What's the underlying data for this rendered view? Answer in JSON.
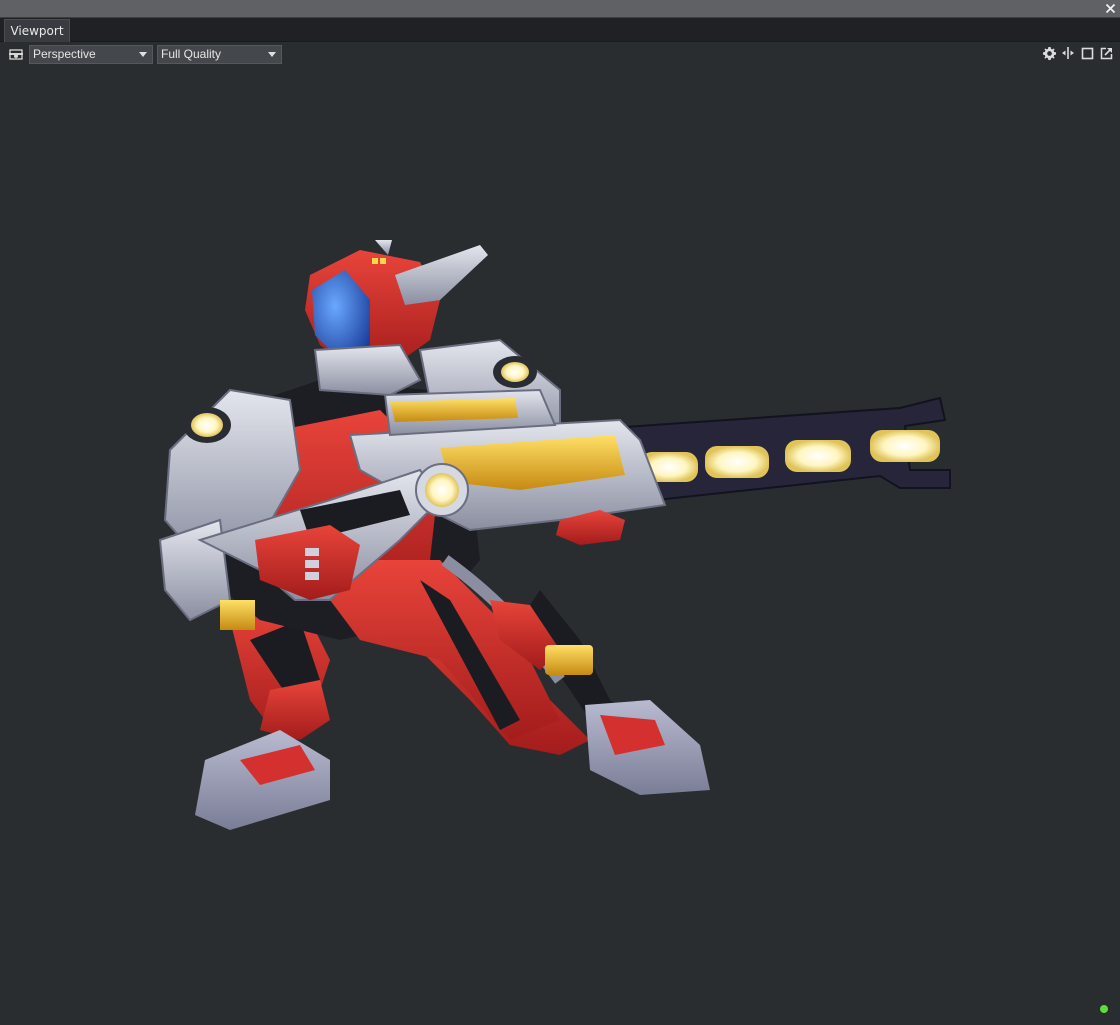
{
  "panel": {
    "tab_label": "Viewport"
  },
  "toolbar": {
    "camera_mode": "Perspective",
    "quality": "Full Quality"
  },
  "icons": {
    "camera": "camera-icon",
    "settings": "gear-icon",
    "split": "split-view-icon",
    "maximize": "maximize-icon",
    "popout": "popout-icon",
    "close": "close-icon"
  },
  "colors": {
    "viewport_bg": "#2a2d30",
    "status_ok": "#5fdc3a"
  }
}
